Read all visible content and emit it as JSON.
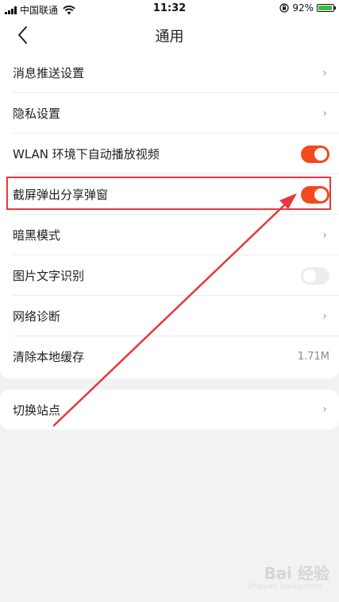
{
  "status_bar": {
    "carrier": "中国联通",
    "time": "11:32",
    "battery_percent": "92%",
    "battery_level": 0.92,
    "icons": [
      "signal-icon",
      "wifi-icon",
      "orientation-lock-icon",
      "battery-icon"
    ]
  },
  "nav": {
    "title": "通用",
    "back_icon": "back-chevron-icon"
  },
  "settings": [
    {
      "label": "消息推送设置",
      "type": "link"
    },
    {
      "label": "隐私设置",
      "type": "link"
    },
    {
      "label": "WLAN 环境下自动播放视频",
      "type": "toggle",
      "on": true
    },
    {
      "label": "截屏弹出分享弹窗",
      "type": "toggle",
      "on": true
    },
    {
      "label": "暗黑模式",
      "type": "link"
    },
    {
      "label": "图片文字识别",
      "type": "toggle",
      "on": false
    },
    {
      "label": "网络诊断",
      "type": "link"
    },
    {
      "label": "清除本地缓存",
      "type": "value",
      "value": "1.71M"
    }
  ],
  "second_group": [
    {
      "label": "切换站点",
      "type": "link"
    }
  ],
  "chevron_glyph": "›",
  "colors": {
    "accent": "#f24a1d",
    "annotation": "#e8363b",
    "background": "#f2f2f4"
  },
  "watermark": {
    "brand": "Bai 经验",
    "url": "jingyan.baidu.com"
  }
}
